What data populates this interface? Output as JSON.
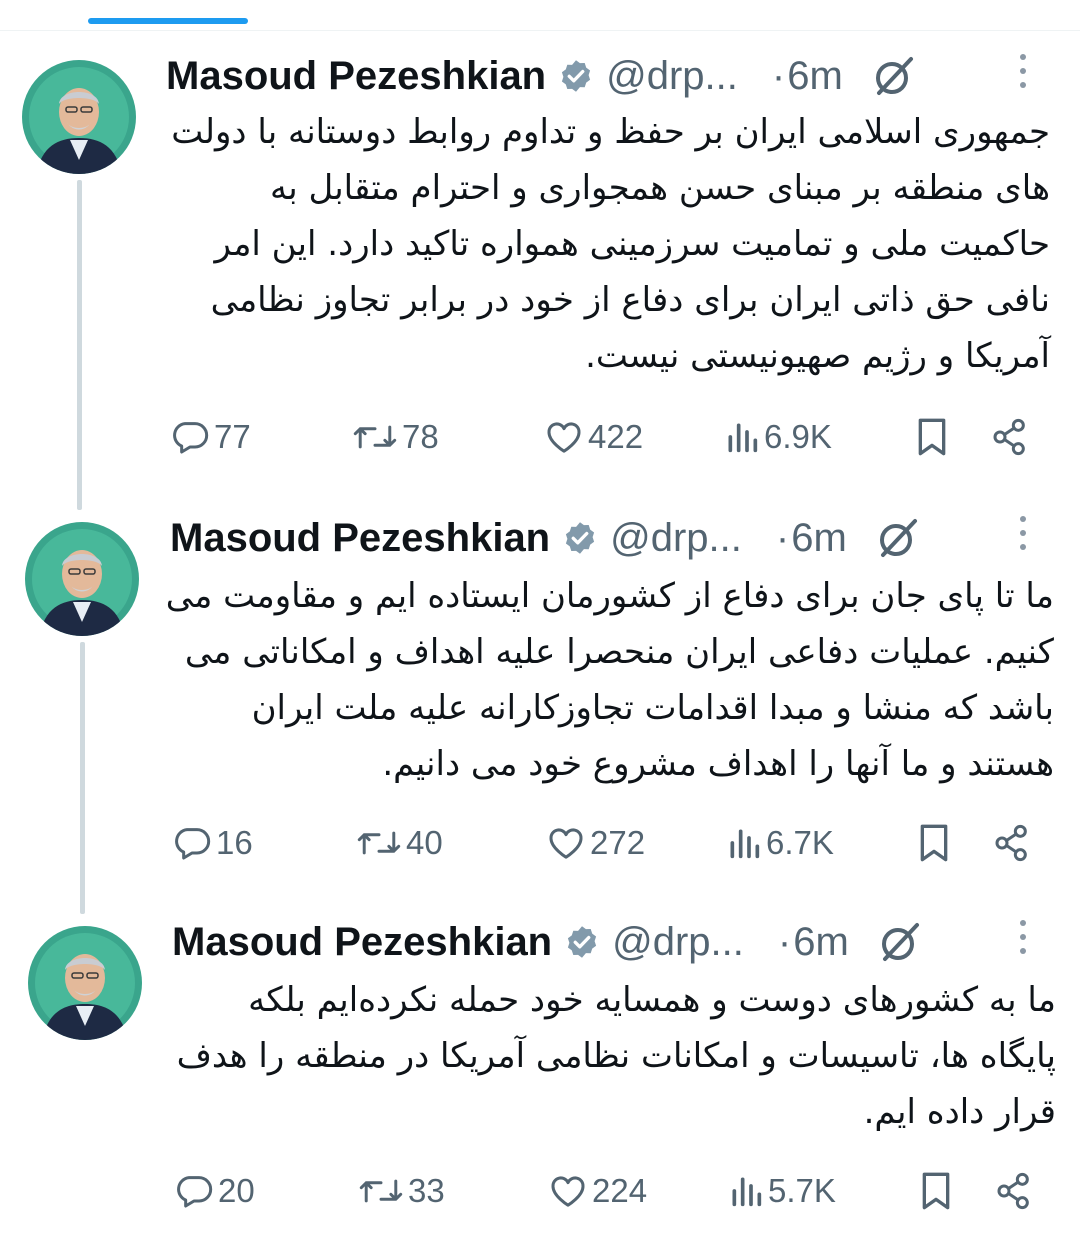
{
  "colors": {
    "accent": "#1d9bf0",
    "text": "#0f1419",
    "secondary": "#536471",
    "thread_line": "#cfd9de"
  },
  "tweets": [
    {
      "author": {
        "name": "Masoud Pezeshkian",
        "handle": "@drp...",
        "verified": true
      },
      "time_dot": "·",
      "time": "6m",
      "text": "جمهوری اسلامی ایران بر حفظ و تداوم روابط دوستانه با دولت های منطقه بر مبنای حسن همجواری و احترام متقابل به حاکمیت ملی و تمامیت سرزمینی همواره تاکید دارد. این امر نافی حق ذاتی ایران برای دفاع از خود در برابر تجاوز نظامی آمریکا و رژیم صهیونیستی نیست.",
      "stats": {
        "replies": "77",
        "reposts": "78",
        "likes": "422",
        "views": "6.9K"
      }
    },
    {
      "author": {
        "name": "Masoud Pezeshkian",
        "handle": "@drp...",
        "verified": true
      },
      "time_dot": "·",
      "time": "6m",
      "text": "ما تا پای جان برای دفاع از کشورمان ایستاده ایم و مقاومت می کنیم. عملیات دفاعی ایران منحصرا علیه اهداف و امکاناتی می باشد که منشا و مبدا اقدامات تجاوزکارانه علیه ملت ایران هستند و ما آنها را اهداف مشروع خود می دانیم.",
      "stats": {
        "replies": "16",
        "reposts": "40",
        "likes": "272",
        "views": "6.7K"
      }
    },
    {
      "author": {
        "name": "Masoud Pezeshkian",
        "handle": "@drp...",
        "verified": true
      },
      "time_dot": "·",
      "time": "6m",
      "text": "ما به کشورهای دوست و همسایه خود حمله نکرده‌ایم بلکه پایگاه ها، تاسیسات و امکانات نظامی آمریکا در منطقه را هدف قرار داده ایم.",
      "stats": {
        "replies": "20",
        "reposts": "33",
        "likes": "224",
        "views": "5.7K"
      }
    }
  ]
}
